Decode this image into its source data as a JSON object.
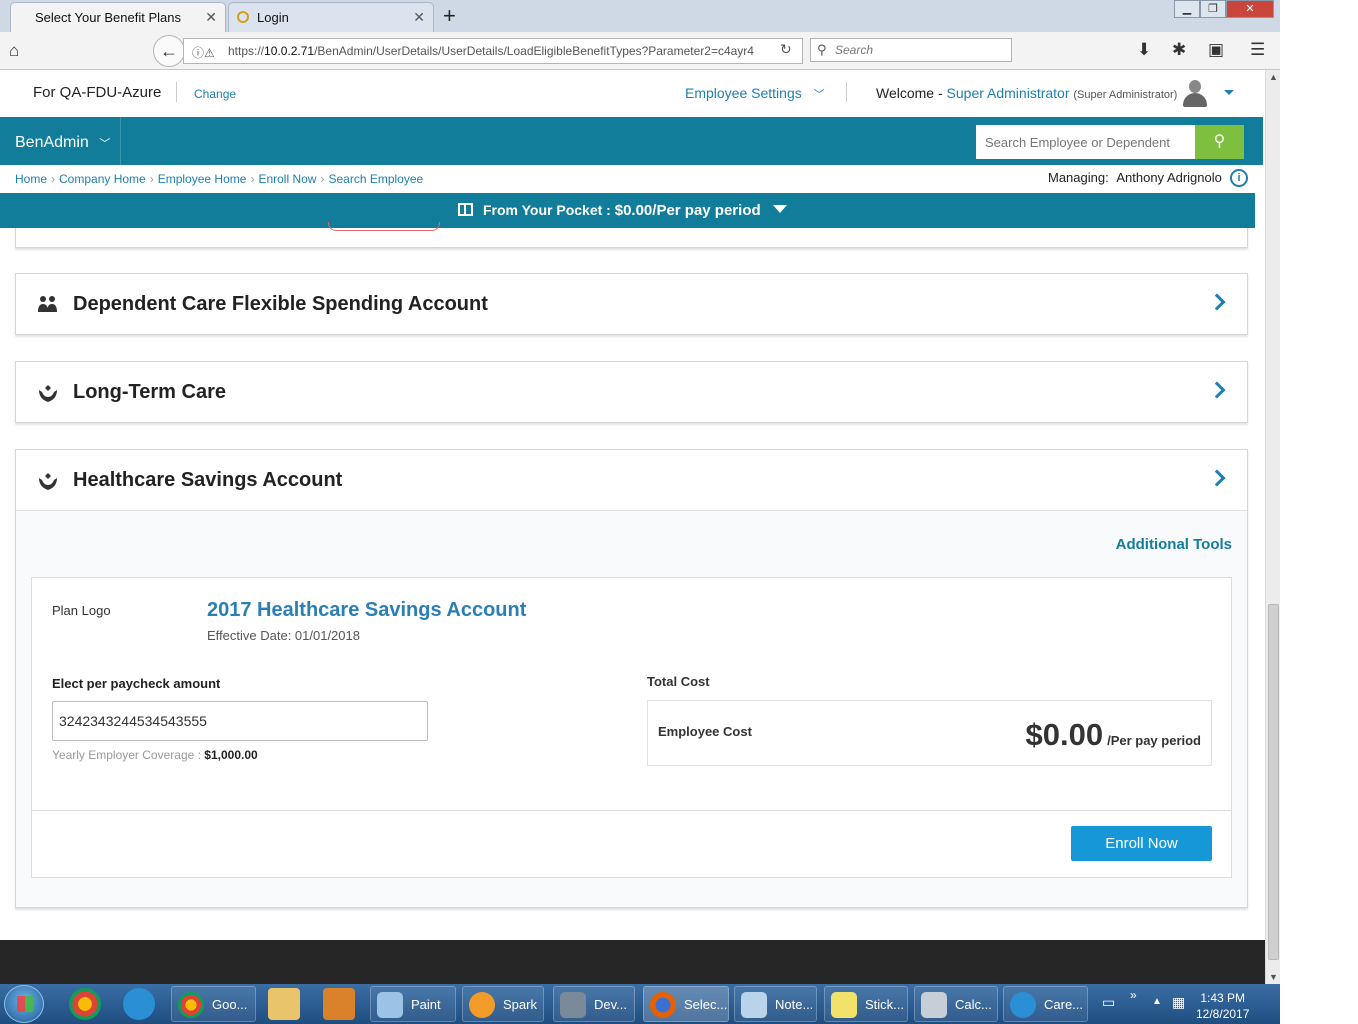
{
  "browser": {
    "tabs": [
      {
        "title": "Select Your Benefit Plans",
        "active": true
      },
      {
        "title": "Login",
        "active": false
      }
    ],
    "url_scheme": "https://",
    "url_host": "10.0.2.71",
    "url_path": "/BenAdmin/UserDetails/UserDetails/LoadEligibleBenefitTypes?Parameter2=c4ayr4",
    "search_placeholder": "Search"
  },
  "header": {
    "company": "For QA-FDU-Azure",
    "change_link": "Change",
    "employee_settings": "Employee Settings",
    "welcome_prefix": "Welcome - ",
    "user_name": "Super Administrator",
    "user_role": "(Super Administrator)"
  },
  "nav": {
    "app_name": "BenAdmin",
    "search_placeholder": "Search Employee or Dependent"
  },
  "breadcrumb": [
    "Home",
    "Company Home",
    "Employee Home",
    "Enroll Now",
    "Search Employee"
  ],
  "managing": {
    "label": "Managing:",
    "name": "Anthony Adrignolo"
  },
  "pocket": {
    "label": "From Your Pocket : ",
    "amount": "$0.00/Per pay period"
  },
  "cards": [
    {
      "title": "Dependent Care Flexible Spending Account"
    },
    {
      "title": "Long-Term Care"
    },
    {
      "title": "Healthcare Savings Account"
    }
  ],
  "hsa": {
    "additional_tools": "Additional Tools",
    "plan_logo_label": "Plan Logo",
    "plan_name": "2017 Healthcare Savings Account",
    "effective_date": "Effective Date: 01/01/2018",
    "elect_label": "Elect per paycheck amount",
    "elect_value": "3242343244534543555",
    "yearly_label": "Yearly Employer Coverage : ",
    "yearly_value": "$1,000.00",
    "total_cost_label": "Total Cost",
    "employee_cost_label": "Employee Cost",
    "employee_cost_value": "$0.00",
    "per_period": "/Per pay period",
    "enroll_button": "Enroll Now"
  },
  "taskbar": {
    "items": [
      "Goo...",
      "Paint",
      "Spark",
      "Dev...",
      "Selec...",
      "Note...",
      "Stick...",
      "Calc...",
      "Care..."
    ],
    "time": "1:43 PM",
    "date": "12/8/2017"
  },
  "colors": {
    "brand_teal": "#127d9a",
    "link_blue": "#1f7fb0",
    "search_green": "#7fbf3f",
    "enroll_blue": "#1698d8"
  }
}
